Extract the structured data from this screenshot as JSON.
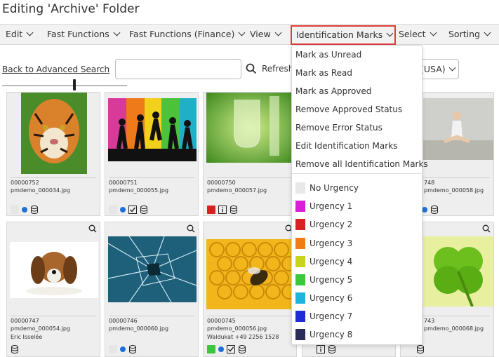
{
  "title": "Editing 'Archive' Folder",
  "menu": [
    "Edit",
    "Fast Functions",
    "Fast Functions (Finance)",
    "View",
    "Identification Marks",
    "Select",
    "Sorting"
  ],
  "active_menu": "Identification Marks",
  "toolbar": {
    "back_link": "Back to Advanced Search",
    "search_placeholder": "",
    "refresh_label": "Refresh",
    "lang_value": "(USA)"
  },
  "dropdown": {
    "actions": [
      "Mark as Unread",
      "Mark as Read",
      "Mark as Approved",
      "Remove Approved Status",
      "Remove Error Status",
      "Edit Identification Marks",
      "Remove all Identification Marks"
    ],
    "urgencies": [
      {
        "label": "No Urgency",
        "color": "#e8e8e8"
      },
      {
        "label": "Urgency 1",
        "color": "#d81ed8"
      },
      {
        "label": "Urgency 2",
        "color": "#d82222"
      },
      {
        "label": "Urgency 3",
        "color": "#f27c14"
      },
      {
        "label": "Urgency 4",
        "color": "#c8d41c"
      },
      {
        "label": "Urgency 5",
        "color": "#3cc83c"
      },
      {
        "label": "Urgency 6",
        "color": "#1eb4dc"
      },
      {
        "label": "Urgency 7",
        "color": "#1e2cd8"
      },
      {
        "label": "Urgency 8",
        "color": "#2c2c5a"
      }
    ]
  },
  "cards": [
    {
      "number": "00000752",
      "file": "pmdemo_000034.jpg",
      "credit": ""
    },
    {
      "number": "00000751",
      "file": "pmdemo_000055.jpg",
      "credit": ""
    },
    {
      "number": "00000750",
      "file": "pmdemo_000057.jpg",
      "credit": ""
    },
    {
      "number": "748",
      "file": "pmdemo_000058.jpg",
      "credit": ""
    },
    {
      "number": "00000747",
      "file": "pmdemo_000054.jpg",
      "credit": "Eric Isselée"
    },
    {
      "number": "00000746",
      "file": "pmdemo_000060.jpg",
      "credit": ""
    },
    {
      "number": "00000745",
      "file": "pmdemo_000056.jpg",
      "credit": "Waldukat +49 2256 1528"
    },
    {
      "number": "743",
      "file": "pmdemo_000068.jpg",
      "credit": ""
    }
  ],
  "colors": {
    "accent_blue": "#1f6fd6",
    "active_border": "#e03c3c",
    "urgency2_red": "#d82222",
    "urgency5_green": "#3cc83c"
  }
}
